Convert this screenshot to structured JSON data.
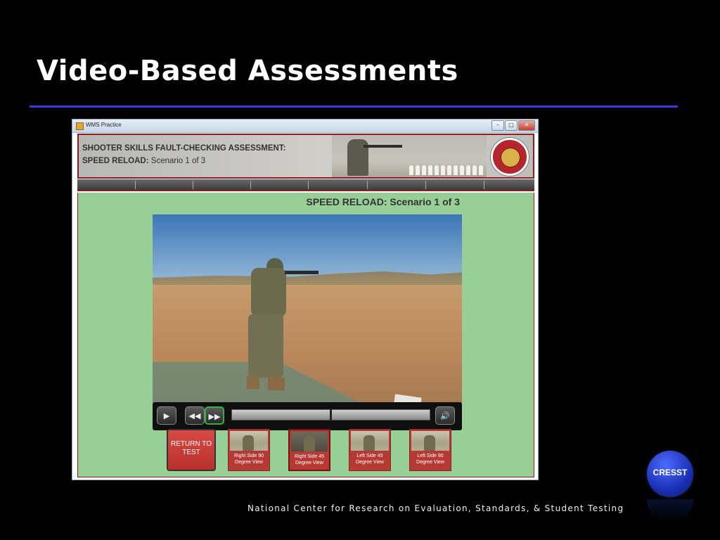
{
  "slide": {
    "title": "Video-Based Assessments",
    "footer": "National Center for Research on Evaluation, Standards, & Student Testing",
    "logo_text": "CRESST"
  },
  "window": {
    "title": "WMS Practice",
    "controls": {
      "minimize": "–",
      "maximize": "□",
      "close": "✕"
    }
  },
  "header": {
    "line1": "SHOOTER SKILLS FAULT-CHECKING ASSESSMENT:",
    "line2_bold": "SPEED RELOAD:",
    "line2_rest": " Scenario 1 of 3"
  },
  "content": {
    "scenario_bold": "SPEED RELOAD:",
    "scenario_rest": " Scenario 1 of 3"
  },
  "player": {
    "play_icon": "play-icon",
    "rewind_icon": "rewind-icon",
    "fast_forward_icon": "fast-forward-icon",
    "volume_icon": "volume-icon",
    "progress": 0.5
  },
  "return_button": "RETURN TO TEST",
  "views": [
    {
      "label": "Right Side 90 Degree View",
      "selected": false
    },
    {
      "label": "Right Side 45 Degree View",
      "selected": true
    },
    {
      "label": "Left Side 45 Degree View",
      "selected": false
    },
    {
      "label": "Left Side 90 Degree View",
      "selected": false
    }
  ],
  "colors": {
    "accent_rule": "#3a3adc",
    "content_bg": "#97cf96",
    "frame_red": "#8c1b1b",
    "button_red": "#b53a34",
    "active_green": "#32b23c"
  }
}
